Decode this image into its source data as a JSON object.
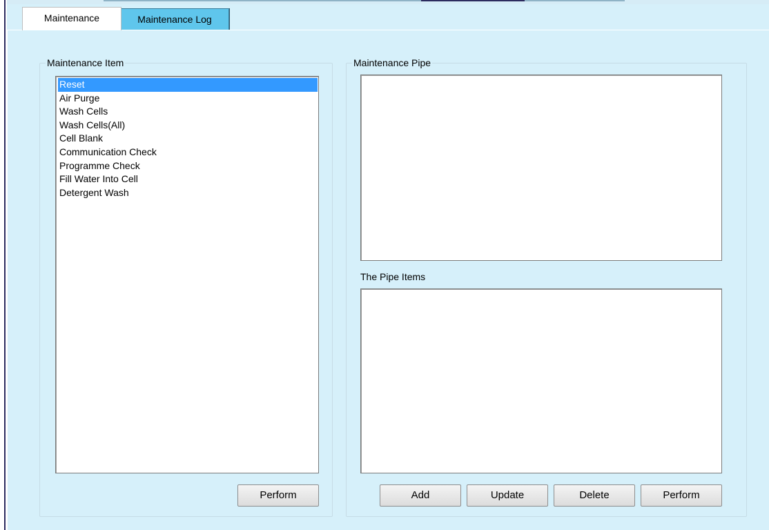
{
  "tabs": [
    {
      "label": "Maintenance",
      "active": true
    },
    {
      "label": "Maintenance Log",
      "active": false
    }
  ],
  "maintenance_item": {
    "title": "Maintenance Item",
    "items": [
      "Reset",
      "Air Purge",
      "Wash Cells",
      "Wash Cells(All)",
      "Cell Blank",
      "Communication Check",
      "Programme Check",
      "Fill Water Into Cell",
      "Detergent Wash"
    ],
    "selected": "Reset",
    "perform_label": "Perform"
  },
  "maintenance_pipe": {
    "title": "Maintenance Pipe",
    "pipes": [],
    "pipe_items_title": "The Pipe Items",
    "pipe_items": [],
    "buttons": {
      "add": "Add",
      "update": "Update",
      "delete": "Delete",
      "perform": "Perform"
    }
  },
  "colors": {
    "background": "#d6f0fa",
    "active_tab": "#ffffff",
    "inactive_tab": "#5fc6ec",
    "selection": "#3399ff"
  }
}
